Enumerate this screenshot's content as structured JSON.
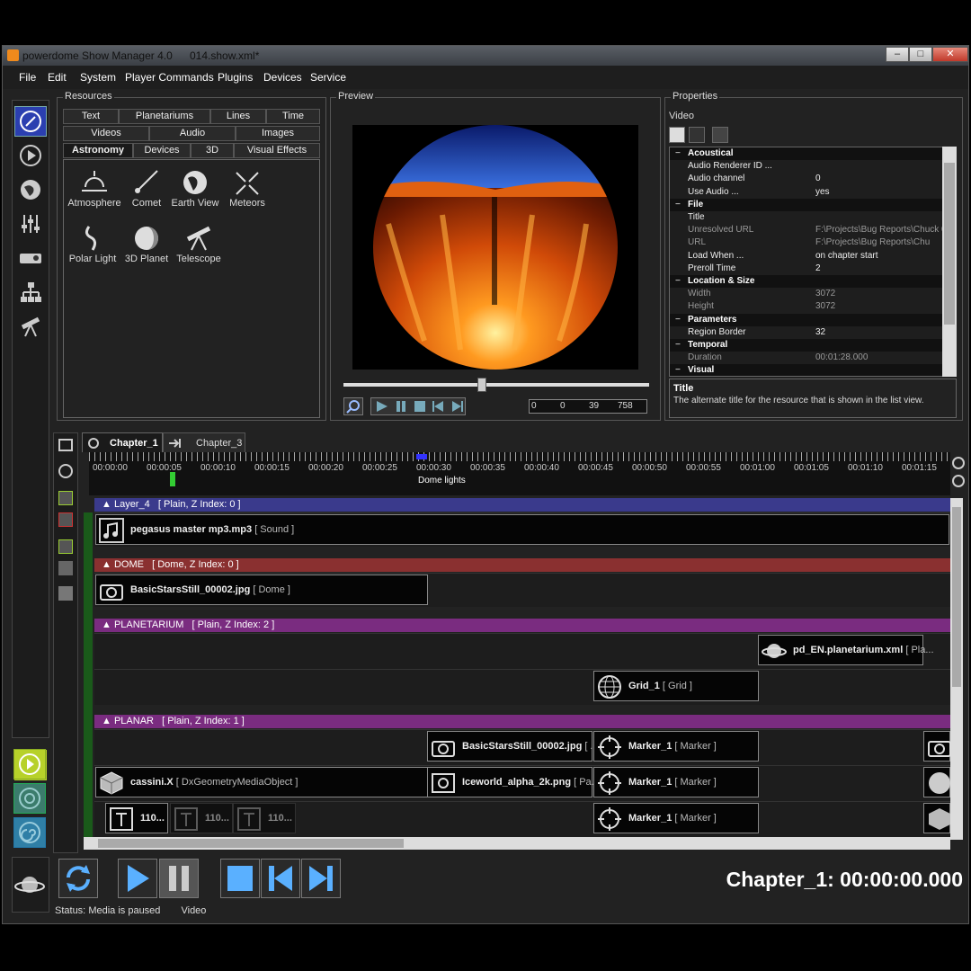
{
  "window": {
    "app_title": "powerdome Show Manager 4.0",
    "file_name": "014.show.xml*"
  },
  "menu": [
    "File",
    "Edit",
    "System",
    "Player Commands",
    "Plugins",
    "Devices",
    "Service"
  ],
  "resources": {
    "title": "Resources",
    "tabs_row1": [
      "Text",
      "Planetariums",
      "Lines",
      "Time"
    ],
    "tabs_row2": [
      "Videos",
      "Audio",
      "Images"
    ],
    "tabs_row3": [
      "Astronomy",
      "Devices",
      "3D",
      "Visual Effects"
    ],
    "items": [
      "Atmosphere",
      "Comet",
      "Earth View",
      "Meteors",
      "Polar Light",
      "3D Planet",
      "Telescope"
    ]
  },
  "preview": {
    "title": "Preview",
    "counters": [
      "0",
      "0",
      "39",
      "758"
    ]
  },
  "properties": {
    "title": "Properties",
    "subtitle": "Video",
    "rows": [
      {
        "k": "Acoustical",
        "v": "",
        "type": "cat"
      },
      {
        "k": "Audio Renderer ID ...",
        "v": "",
        "type": ""
      },
      {
        "k": "Audio channel",
        "v": "0",
        "type": ""
      },
      {
        "k": "Use Audio ...",
        "v": "yes",
        "type": ""
      },
      {
        "k": "File",
        "v": "",
        "type": "cat"
      },
      {
        "k": "Title",
        "v": "",
        "type": ""
      },
      {
        "k": "Unresolved URL",
        "v": "F:\\Projects\\Bug Reports\\Chuck 0",
        "type": "dim"
      },
      {
        "k": "URL",
        "v": "F:\\Projects\\Bug Reports\\Chu",
        "type": "dim"
      },
      {
        "k": "Load When ...",
        "v": "on chapter start",
        "type": ""
      },
      {
        "k": "Preroll Time",
        "v": "2",
        "type": ""
      },
      {
        "k": "Location & Size",
        "v": "",
        "type": "cat"
      },
      {
        "k": "Width",
        "v": "3072",
        "type": "dim"
      },
      {
        "k": "Height",
        "v": "3072",
        "type": "dim"
      },
      {
        "k": "Parameters",
        "v": "",
        "type": "cat"
      },
      {
        "k": "Region Border",
        "v": "32",
        "type": ""
      },
      {
        "k": "Temporal",
        "v": "",
        "type": "cat"
      },
      {
        "k": "Duration",
        "v": "00:01:28.000",
        "type": "dim"
      },
      {
        "k": "Visual",
        "v": "",
        "type": "cat"
      }
    ],
    "desc_title": "Title",
    "desc_text": "The alternate title for the resource that is shown in the list view."
  },
  "timeline": {
    "chapter_tabs": [
      "Chapter_1",
      "Chapter_3"
    ],
    "ruler": [
      "00:00:00",
      "00:00:05",
      "00:00:10",
      "00:00:15",
      "00:00:20",
      "00:00:25",
      "00:00:30",
      "00:00:35",
      "00:00:40",
      "00:00:45",
      "00:00:50",
      "00:00:55",
      "00:01:00",
      "00:01:05",
      "00:01:10",
      "00:01:15"
    ],
    "marker_label": "Dome lights",
    "layers": [
      {
        "label": "Layer_4",
        "info": "[ Plain, Z Index: 0 ]",
        "color": "#3a3a8c"
      },
      {
        "label": "DOME",
        "info": "[ Dome, Z Index: 0 ]",
        "color": "#8a3030"
      },
      {
        "label": "PLANETARIUM",
        "info": "[ Plain, Z Index: 2 ]",
        "color": "#7a2c80"
      },
      {
        "label": "PLANAR",
        "info": "[ Plain, Z Index: 1 ]",
        "color": "#7a2c80"
      }
    ],
    "clips": {
      "sound": {
        "name": "pegasus master mp3.mp3",
        "kind": "[ Sound ]"
      },
      "dome": {
        "name": "BasicStarsStill_00002.jpg",
        "kind": "[ Dome ]"
      },
      "planetarium": {
        "name": "pd_EN.planetarium.xml",
        "kind": "[ Pla..."
      },
      "grid": {
        "name": "Grid_1",
        "kind": "[ Grid ]"
      },
      "planar1": {
        "name": "BasicStarsStill_00002.jpg",
        "kind": "[ ..."
      },
      "marker1": {
        "name": "Marker_1",
        "kind": "[ Marker ]"
      },
      "cassini": {
        "name": "cassini.X",
        "kind": "[ DxGeometryMediaObject ]"
      },
      "iceworld": {
        "name": "Iceworld_alpha_2k.png",
        "kind": "[ Pa..."
      },
      "marker2": {
        "name": "Marker_1",
        "kind": "[ Marker ]"
      },
      "text1": {
        "name": "110...",
        "kind": ""
      },
      "text2": {
        "name": "110...",
        "kind": ""
      },
      "text3": {
        "name": "110...",
        "kind": ""
      },
      "marker3": {
        "name": "Marker_1",
        "kind": "[ Marker ]"
      }
    }
  },
  "transport": {
    "time_display": "Chapter_1: 00:00:00.000"
  },
  "status": {
    "label": "Status:",
    "text": "Media is paused",
    "extra": "Video"
  }
}
